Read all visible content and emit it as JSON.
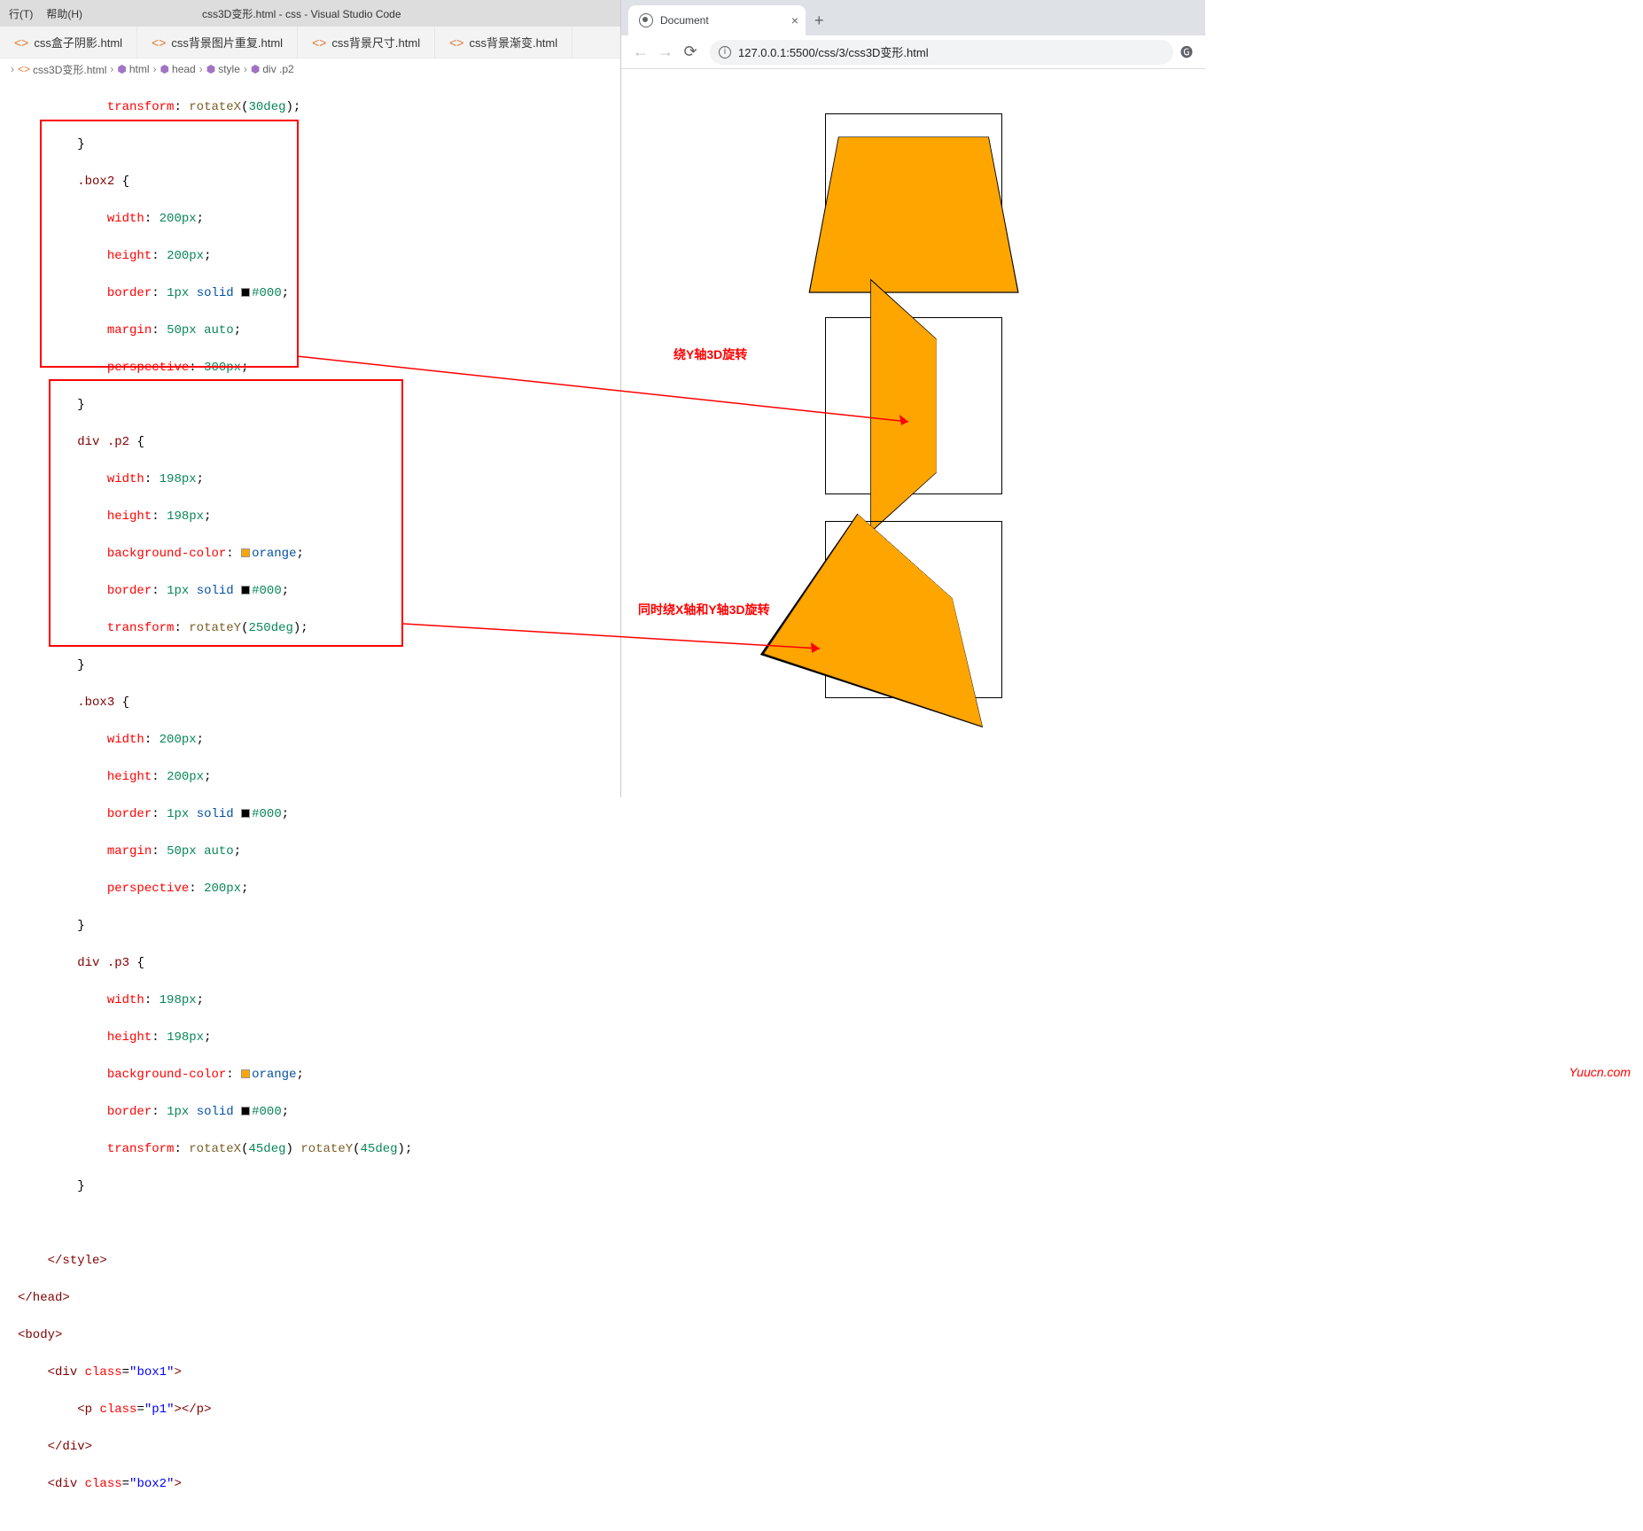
{
  "menubar": {
    "item1": "行(T)",
    "item2": "帮助(H)",
    "title": "css3D变形.html - css - Visual Studio Code"
  },
  "tabs": [
    {
      "label": "css盒子阴影.html"
    },
    {
      "label": "css背景图片重复.html"
    },
    {
      "label": "css背景尺寸.html"
    },
    {
      "label": "css背景渐变.html"
    }
  ],
  "breadcrumb": [
    {
      "label": "css3D变形.html",
      "icon": "file"
    },
    {
      "label": "html",
      "icon": "cube"
    },
    {
      "label": "head",
      "icon": "cube"
    },
    {
      "label": "style",
      "icon": "cube"
    },
    {
      "label": "div .p2",
      "icon": "cube"
    }
  ],
  "code": {
    "l1a": "transform",
    "l1b": "rotateX",
    "l1c": "30deg",
    "sel_box2": ".box2",
    "sel_box3": ".box3",
    "sel_p2": "div .p2",
    "sel_p3": "div .p3",
    "prop_width": "width",
    "prop_height": "height",
    "prop_border": "border",
    "prop_margin": "margin",
    "prop_perspective": "perspective",
    "prop_bg": "background-color",
    "prop_transform": "transform",
    "v200": "200px",
    "v198": "198px",
    "v300": "300px",
    "v50auto": "50px auto",
    "v1px": "1px",
    "vsolid": "solid",
    "vhash000": "#000",
    "vorange": "orange",
    "v250deg": "250deg",
    "v45deg": "45deg",
    "fn_rotX": "rotateX",
    "fn_rotY": "rotateY",
    "tag_style_close": "</style>",
    "tag_head_close": "</head>",
    "tag_body_open": "<body>",
    "div_open": "<div",
    "div_close": "</div>",
    "p_open": "<p",
    "p_close": "></p>",
    "class_attr": "class",
    "cls_box1": "\"box1\"",
    "cls_p1": "\"p1\"",
    "cls_box2": "\"box2\"",
    "gt": ">"
  },
  "annotations": {
    "a1": "绕Y轴3D旋转",
    "a2": "同时绕X轴和Y轴3D旋转"
  },
  "browser": {
    "tabTitle": "Document",
    "url": "127.0.0.1:5500/css/3/css3D变形.html"
  },
  "watermark": "Yuucn.com"
}
